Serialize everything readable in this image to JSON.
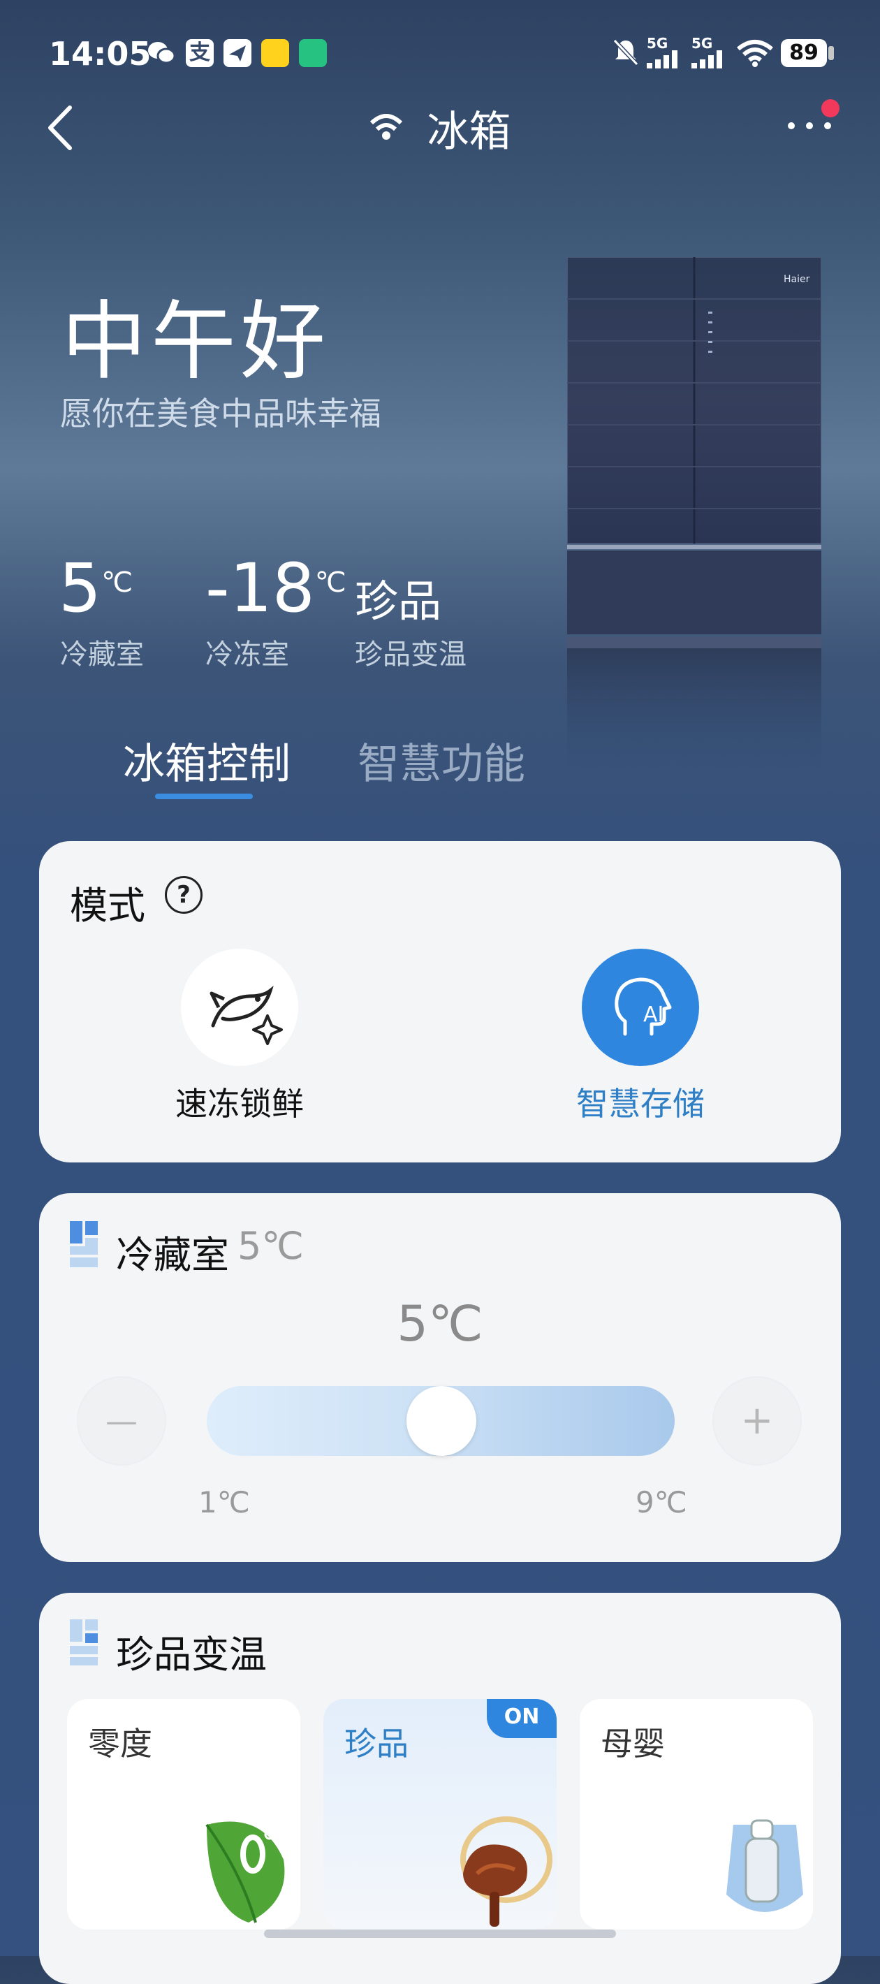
{
  "status_bar": {
    "time": "14:05",
    "signal_1": "5G",
    "signal_2": "5G",
    "battery": "89"
  },
  "header": {
    "title": "冰箱"
  },
  "hero": {
    "greeting": "中午好",
    "subtitle": "愿你在美食中品味幸福",
    "brand": "Haier",
    "stats": [
      {
        "value": "5",
        "unit": "℃",
        "label": "冷藏室"
      },
      {
        "value": "-18",
        "unit": "℃",
        "label": "冷冻室"
      },
      {
        "value": "珍品",
        "unit": "",
        "label": "珍品变温"
      }
    ]
  },
  "tabs": [
    {
      "label": "冰箱控制",
      "active": true
    },
    {
      "label": "智慧功能",
      "active": false
    }
  ],
  "mode_card": {
    "title": "模式",
    "help": "?",
    "modes": [
      {
        "label": "速冻锁鲜",
        "active": false,
        "icon": "fish-sparkle-icon"
      },
      {
        "label": "智慧存储",
        "active": true,
        "icon": "ai-head-icon"
      }
    ]
  },
  "fridge_card": {
    "title": "冷藏室",
    "title_temp": "5℃",
    "current_temp": "5℃",
    "min_label": "1℃",
    "max_label": "9℃",
    "minus": "—",
    "plus": "+",
    "min_value": 1,
    "max_value": 9,
    "value": 5
  },
  "variable_card": {
    "title": "珍品变温",
    "options": [
      {
        "label": "零度",
        "active": false,
        "badge": "",
        "icon": "leaf-zero-icon"
      },
      {
        "label": "珍品",
        "active": true,
        "badge": "ON",
        "icon": "mushroom-icon"
      },
      {
        "label": "母婴",
        "active": false,
        "badge": "",
        "icon": "baby-bottle-icon"
      }
    ]
  },
  "colors": {
    "accent": "#3a8de0",
    "active_text": "#2f7fc6",
    "notification": "#f2395c"
  }
}
